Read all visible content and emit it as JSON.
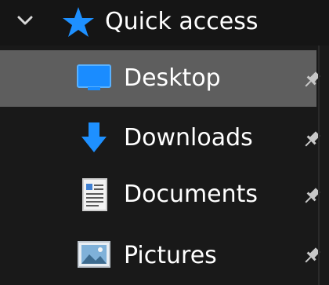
{
  "quick_access": {
    "label": "Quick access",
    "expanded": true,
    "icon": "star-icon",
    "accent": "#1e90ff"
  },
  "items": [
    {
      "label": "Desktop",
      "icon": "desktop-icon",
      "pinned": true,
      "selected": true
    },
    {
      "label": "Downloads",
      "icon": "download-arrow-icon",
      "pinned": true,
      "selected": false
    },
    {
      "label": "Documents",
      "icon": "document-icon",
      "pinned": true,
      "selected": false
    },
    {
      "label": "Pictures",
      "icon": "pictures-icon",
      "pinned": true,
      "selected": false
    }
  ],
  "colors": {
    "background": "#191919",
    "selected_row": "#5e5e5e",
    "text": "#ffffff",
    "pin": "#c8c8c8"
  }
}
